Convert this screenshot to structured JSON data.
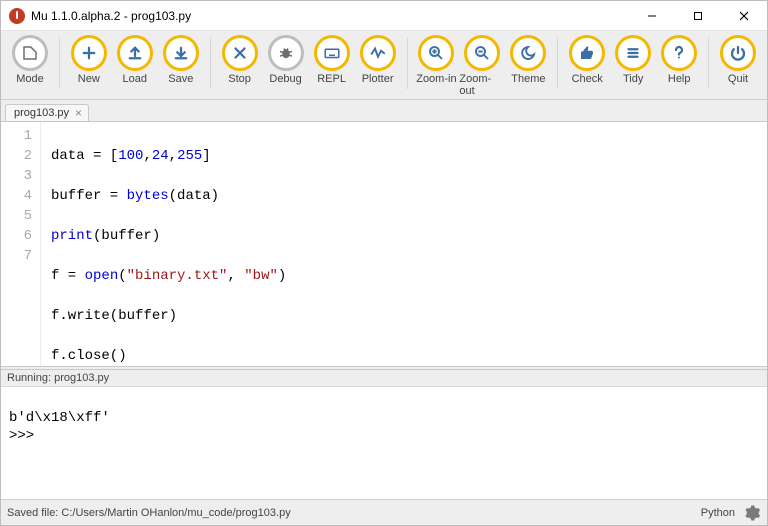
{
  "window": {
    "title": "Mu 1.1.0.alpha.2 - prog103.py"
  },
  "toolbar": {
    "mode": "Mode",
    "new": "New",
    "load": "Load",
    "save": "Save",
    "stop": "Stop",
    "debug": "Debug",
    "repl": "REPL",
    "plotter": "Plotter",
    "zoom_in": "Zoom-in",
    "zoom_out": "Zoom-out",
    "theme": "Theme",
    "check": "Check",
    "tidy": "Tidy",
    "help": "Help",
    "quit": "Quit"
  },
  "tab": {
    "label": "prog103.py"
  },
  "code": {
    "l1a": "data = [",
    "l1n1": "100",
    "l1c1": ",",
    "l1n2": "24",
    "l1c2": ",",
    "l1n3": "255",
    "l1b": "]",
    "l2a": "buffer = ",
    "l2fn": "bytes",
    "l2b": "(data)",
    "l3fn": "print",
    "l3b": "(buffer)",
    "l4a": "f = ",
    "l4fn": "open",
    "l4b": "(",
    "l4s1": "\"binary.txt\"",
    "l4c": ", ",
    "l4s2": "\"bw\"",
    "l4d": ")",
    "l5": "f.write(buffer)",
    "l6": "f.close()"
  },
  "gutter": {
    "n1": "1",
    "n2": "2",
    "n3": "3",
    "n4": "4",
    "n5": "5",
    "n6": "6",
    "n7": "7"
  },
  "runner": {
    "title": "Running: prog103.py",
    "out1": "b'd\\x18\\xff'",
    "out2": ">>> "
  },
  "status": {
    "message": "Saved file: C:/Users/Martin OHanlon/mu_code/prog103.py",
    "lang": "Python"
  }
}
